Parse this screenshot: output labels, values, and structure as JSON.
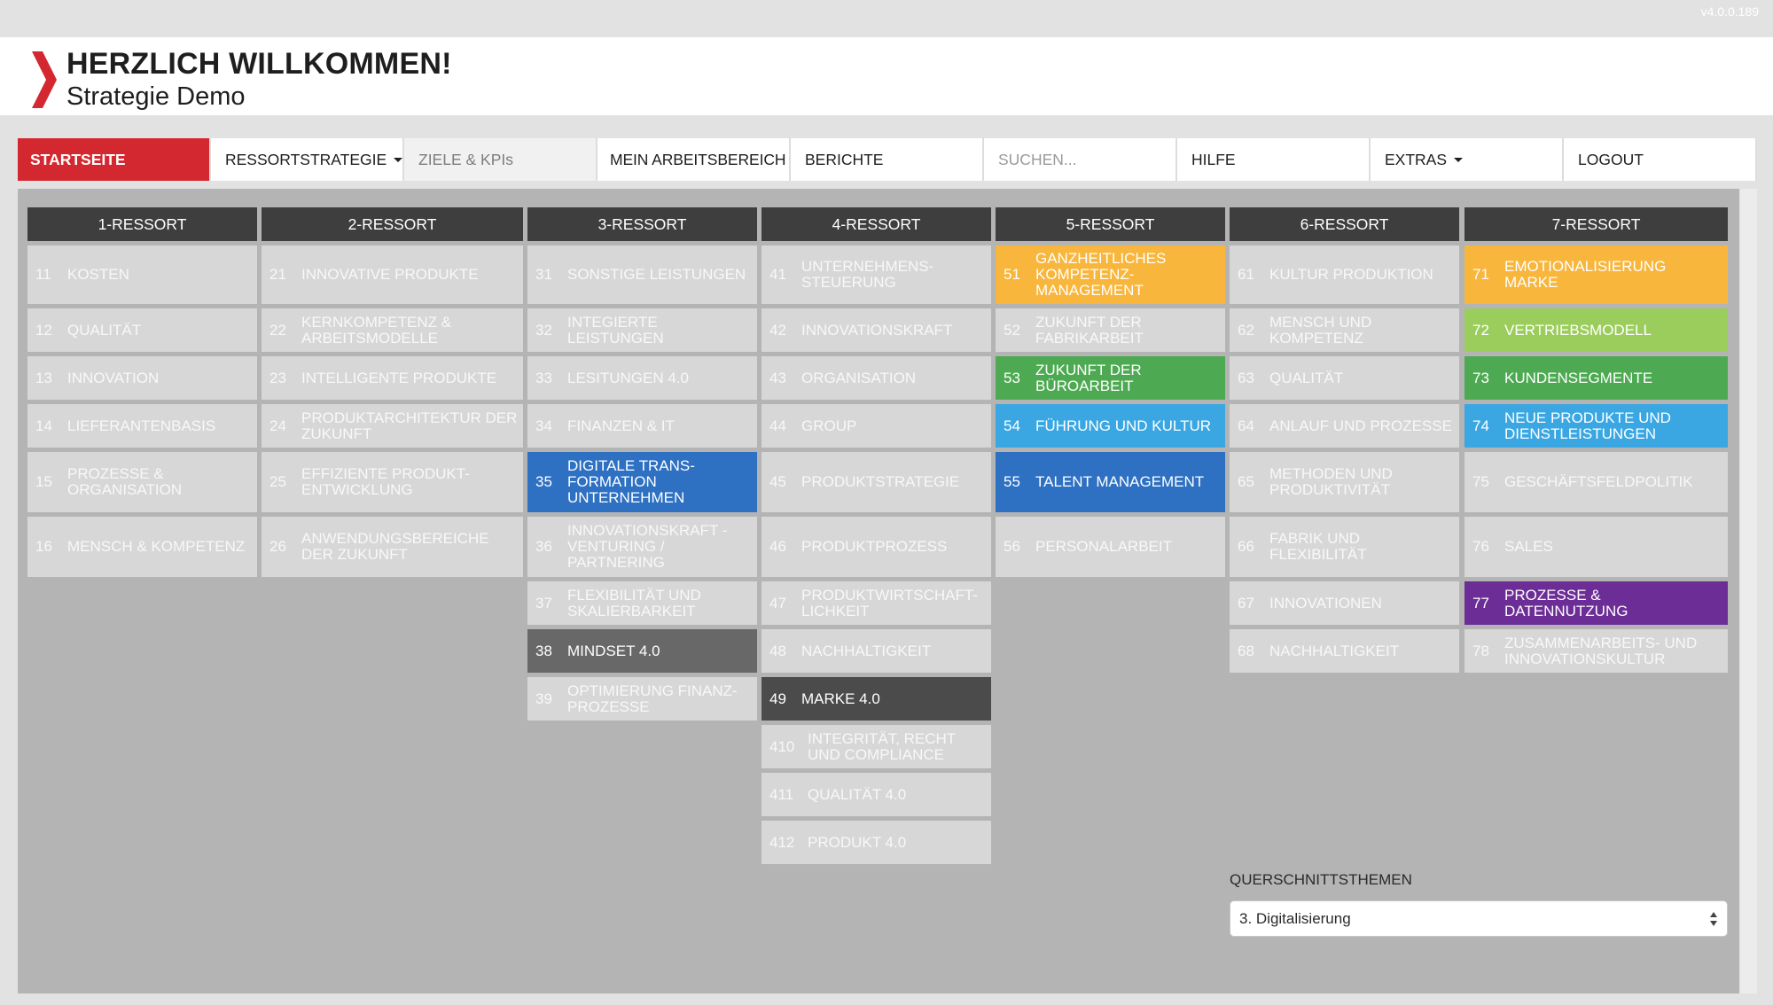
{
  "version": "v4.0.0.189",
  "header": {
    "title": "HERZLICH WILLKOMMEN!",
    "subtitle": "Strategie Demo"
  },
  "nav": {
    "startseite": "STARTSEITE",
    "ressortstrategie": "RESSORTSTRATEGIE",
    "ziele": "ZIELE & KPIs",
    "arbeitsbereich": "MEIN ARBEITSBEREICH",
    "berichte": "BERICHTE",
    "search_placeholder": "SUCHEN...",
    "hilfe": "HILFE",
    "extras": "EXTRAS",
    "logout": "LOGOUT"
  },
  "columns": [
    {
      "title": "1-RESSORT",
      "items": [
        {
          "num": "11",
          "label": "Kosten"
        },
        {
          "num": "12",
          "label": "Qualität"
        },
        {
          "num": "13",
          "label": "Innovation"
        },
        {
          "num": "14",
          "label": "Lieferantenbasis"
        },
        {
          "num": "15",
          "label": "Prozesse & Organisation"
        },
        {
          "num": "16",
          "label": "Mensch & Kompetenz"
        }
      ]
    },
    {
      "title": "2-RESSORT",
      "items": [
        {
          "num": "21",
          "label": "Innovative Produkte"
        },
        {
          "num": "22",
          "label": "Kernkompetenz & Arbeitsmodelle"
        },
        {
          "num": "23",
          "label": "Intelligente Produkte"
        },
        {
          "num": "24",
          "label": "Produktarchitektur der Zukunft"
        },
        {
          "num": "25",
          "label": "Effiziente Produkt-entwicklung"
        },
        {
          "num": "26",
          "label": "Anwendungsbereiche der Zukunft"
        }
      ]
    },
    {
      "title": "3-RESSORT",
      "items": [
        {
          "num": "31",
          "label": "Sonstige Leistungen"
        },
        {
          "num": "32",
          "label": "Integierte Leistungen"
        },
        {
          "num": "33",
          "label": "Lesitungen 4.0"
        },
        {
          "num": "34",
          "label": "Finanzen & IT"
        },
        {
          "num": "35",
          "label": "Digitale Trans-formation Unternehmen"
        },
        {
          "num": "36",
          "label": "Innovationskraft - Venturing / Partnering"
        },
        {
          "num": "37",
          "label": "Flexibilität und Skalierbarkeit"
        },
        {
          "num": "38",
          "label": "Mindset 4.0"
        },
        {
          "num": "39",
          "label": "Optimierung Finanz-prozesse"
        }
      ]
    },
    {
      "title": "4-RESSORT",
      "items": [
        {
          "num": "41",
          "label": "Unternehmens-steuerung"
        },
        {
          "num": "42",
          "label": "Innovationskraft"
        },
        {
          "num": "43",
          "label": "Organisation"
        },
        {
          "num": "44",
          "label": "Group"
        },
        {
          "num": "45",
          "label": "Produktstrategie"
        },
        {
          "num": "46",
          "label": "Produktprozess"
        },
        {
          "num": "47",
          "label": "Produktwirtschaft-lichkeit"
        },
        {
          "num": "48",
          "label": "Nachhaltigkeit"
        },
        {
          "num": "49",
          "label": "Marke 4.0"
        },
        {
          "num": "410",
          "label": "Integrität, Recht und Compliance"
        },
        {
          "num": "411",
          "label": "Qualität 4.0"
        },
        {
          "num": "412",
          "label": "Produkt 4.0"
        }
      ]
    },
    {
      "title": "5-RESSORT",
      "items": [
        {
          "num": "51",
          "label": "Ganzheitliches Kompetenz-management"
        },
        {
          "num": "52",
          "label": "Zukunft der Fabrikarbeit"
        },
        {
          "num": "53",
          "label": "Zukunft der Büroarbeit"
        },
        {
          "num": "54",
          "label": "Führung und Kultur"
        },
        {
          "num": "55",
          "label": "Talent Management"
        },
        {
          "num": "56",
          "label": "Personalarbeit"
        }
      ]
    },
    {
      "title": "6-RESSORT",
      "items": [
        {
          "num": "61",
          "label": "Kultur Produktion"
        },
        {
          "num": "62",
          "label": "Mensch und Kompetenz"
        },
        {
          "num": "63",
          "label": "Qualität"
        },
        {
          "num": "64",
          "label": "Anlauf und Prozesse"
        },
        {
          "num": "65",
          "label": "Methoden und Produktivität"
        },
        {
          "num": "66",
          "label": "Fabrik und Flexibilität"
        },
        {
          "num": "67",
          "label": "Innovationen"
        },
        {
          "num": "68",
          "label": "Nachhaltigkeit"
        }
      ]
    },
    {
      "title": "7-RESSORT",
      "items": [
        {
          "num": "71",
          "label": "Emotionalisierung Marke"
        },
        {
          "num": "72",
          "label": "Vertriebsmodell"
        },
        {
          "num": "73",
          "label": "Kundensegmente"
        },
        {
          "num": "74",
          "label": "Neue Produkte und Dienstleistungen"
        },
        {
          "num": "75",
          "label": "Geschäftsfeldpolitik"
        },
        {
          "num": "76",
          "label": "Sales"
        },
        {
          "num": "77",
          "label": "Prozesse & Datennutzung"
        },
        {
          "num": "78",
          "label": "Zusammenarbeits- und Innovationskultur"
        }
      ]
    }
  ],
  "colors": {
    "brand_red": "#d32830",
    "orange": "#f8b63c",
    "green": "#4daa52",
    "lime": "#9bcd5c",
    "blue": "#2e70c2",
    "sky": "#3aa7e3",
    "purple": "#6c2d97",
    "dark_grey": "#686868",
    "darker_grey": "#4b4b4b"
  },
  "querschnitt": {
    "label": "QUERSCHNITTSTHEMEN",
    "selected": "3. Digitalisierung"
  }
}
